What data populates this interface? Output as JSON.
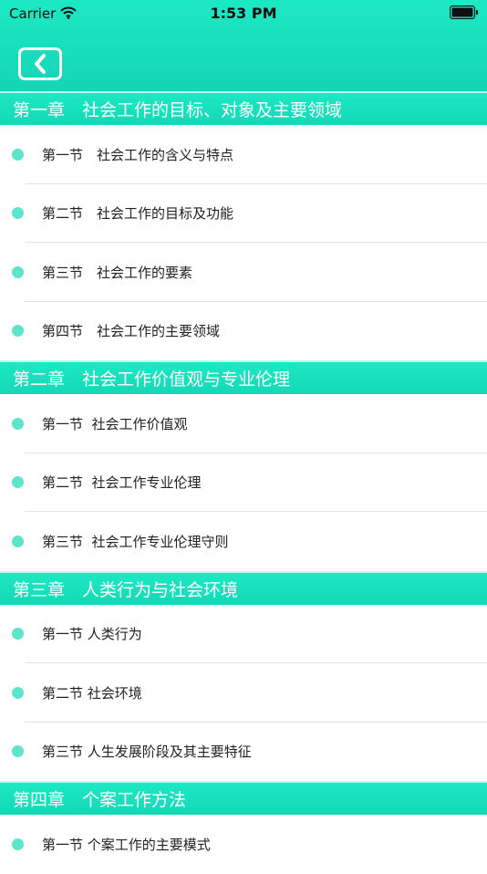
{
  "status_bar": {
    "carrier": "Carrier",
    "time": "1:53 PM"
  },
  "icons": {
    "back": "chevron-left-icon",
    "wifi": "wifi-icon",
    "battery": "battery-icon"
  },
  "colors": {
    "accent": "#1de9c4",
    "dot": "#5de5c9"
  },
  "chapters": [
    {
      "title": "第一章　社会工作的目标、对象及主要领域",
      "sections": [
        "第一节　社会工作的含义与特点",
        "第二节　社会工作的目标及功能",
        "第三节　社会工作的要素",
        "第四节　社会工作的主要领域"
      ]
    },
    {
      "title": "第二章　社会工作价值观与专业伦理",
      "sections": [
        "第一节  社会工作价值观",
        "第二节  社会工作专业伦理",
        "第三节  社会工作专业伦理守则"
      ]
    },
    {
      "title": "第三章　人类行为与社会环境",
      "sections": [
        "第一节 人类行为",
        "第二节 社会环境",
        "第三节 人生发展阶段及其主要特征"
      ]
    },
    {
      "title": "第四章　个案工作方法",
      "sections": [
        "第一节 个案工作的主要模式"
      ]
    }
  ]
}
